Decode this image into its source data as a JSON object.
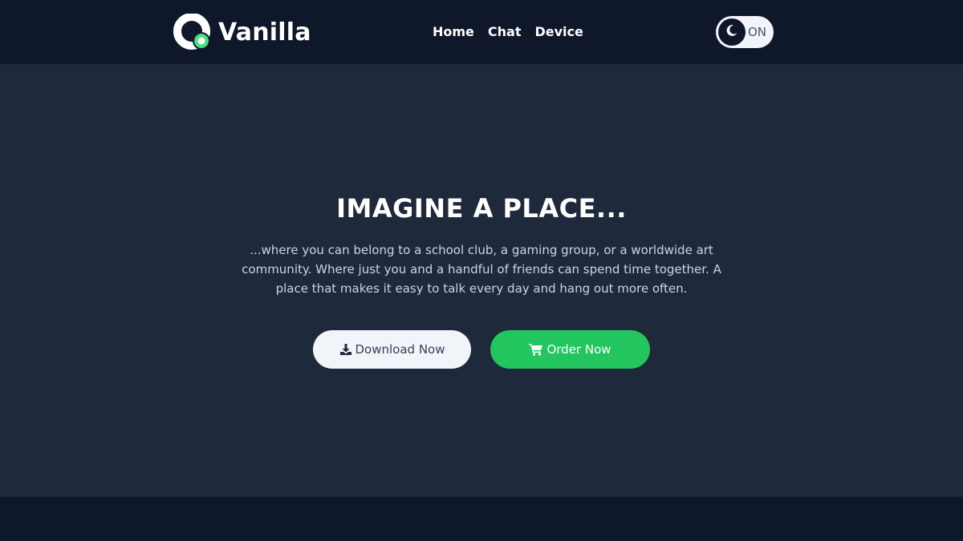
{
  "brand": {
    "name": "Vanilla",
    "logo_icon": "vanilla-logo-icon",
    "logo_color": "#ffffff",
    "status_dot_color": "#4ade80"
  },
  "nav": {
    "items": [
      {
        "label": "Home"
      },
      {
        "label": "Chat"
      },
      {
        "label": "Device"
      }
    ]
  },
  "theme_toggle": {
    "icon": "moon-icon",
    "label": "ON"
  },
  "hero": {
    "title": "IMAGINE A PLACE...",
    "description": "...where you can belong to a school club, a gaming group, or a worldwide art community. Where just you and a handful of friends can spend time together. A place that makes it easy to talk every day and hang out more often.",
    "buttons": {
      "download": {
        "label": "Download Now",
        "icon": "download-icon"
      },
      "order": {
        "label": "Order Now",
        "icon": "cart-icon"
      }
    }
  },
  "colors": {
    "header_bg": "#0f172a",
    "hero_bg": "#1e293b",
    "accent_green": "#22c55e",
    "light_button": "#f1f5f9"
  }
}
